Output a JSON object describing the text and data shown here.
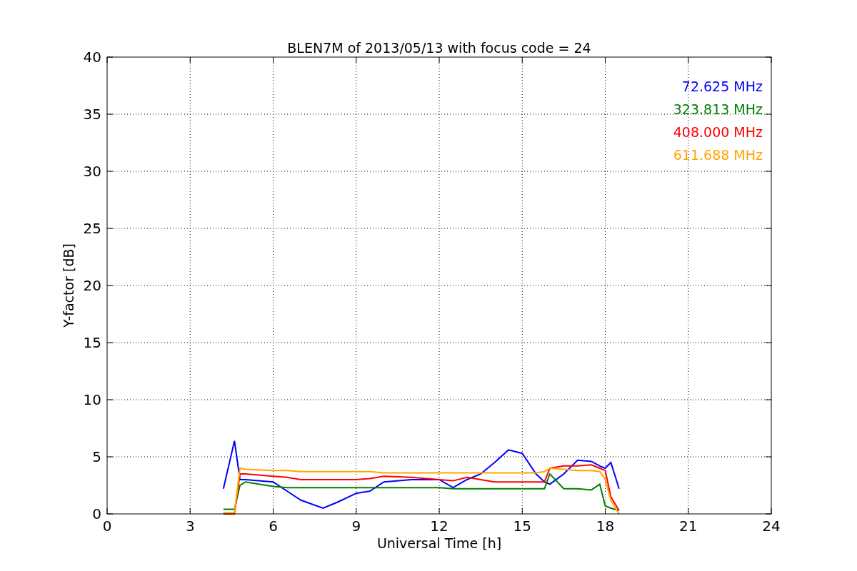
{
  "chart_data": {
    "type": "line",
    "title": "BLEN7M of 2013/05/13 with focus code = 24",
    "xlabel": "Universal Time [h]",
    "ylabel": "Y-factor [dB]",
    "x": [
      4.2,
      4.6,
      4.8,
      5,
      6,
      6.5,
      7,
      7.8,
      8.3,
      9,
      9.5,
      10,
      11,
      12,
      12.5,
      13,
      13.5,
      14,
      14.5,
      15,
      15.5,
      15.8,
      16,
      16.5,
      17,
      17.5,
      17.8,
      18,
      18.2,
      18.5
    ],
    "series": [
      {
        "name": "72.625 MHz",
        "color": "#0000ff",
        "values": [
          2.2,
          6.4,
          3.0,
          3.0,
          2.8,
          2.0,
          1.2,
          0.5,
          1.0,
          1.8,
          2.0,
          2.8,
          3.0,
          3.0,
          2.3,
          3.0,
          3.5,
          4.5,
          5.6,
          5.3,
          3.5,
          2.8,
          2.6,
          3.5,
          4.7,
          4.6,
          4.2,
          4.0,
          4.5,
          2.2
        ]
      },
      {
        "name": "323.813 MHz",
        "color": "#008000",
        "values": [
          0.4,
          0.4,
          2.5,
          2.8,
          2.4,
          2.3,
          2.3,
          2.3,
          2.3,
          2.3,
          2.3,
          2.3,
          2.3,
          2.3,
          2.2,
          2.2,
          2.2,
          2.2,
          2.2,
          2.2,
          2.2,
          2.2,
          3.5,
          2.2,
          2.2,
          2.1,
          2.6,
          0.7,
          0.5,
          0.3
        ]
      },
      {
        "name": "408.000 MHz",
        "color": "#ff0000",
        "values": [
          0,
          0,
          3.5,
          3.5,
          3.3,
          3.2,
          3.0,
          3.0,
          3.0,
          3.0,
          3.1,
          3.3,
          3.2,
          3.0,
          2.9,
          3.2,
          3.0,
          2.8,
          2.8,
          2.8,
          2.8,
          2.8,
          4.0,
          4.2,
          4.2,
          4.3,
          4.0,
          3.8,
          1.5,
          0.3
        ]
      },
      {
        "name": "611.688 MHz",
        "color": "#ffa500",
        "values": [
          0.1,
          0.1,
          4.0,
          3.9,
          3.8,
          3.8,
          3.7,
          3.7,
          3.7,
          3.7,
          3.7,
          3.6,
          3.6,
          3.6,
          3.6,
          3.6,
          3.6,
          3.6,
          3.6,
          3.6,
          3.6,
          3.7,
          4.0,
          3.9,
          3.8,
          3.8,
          3.7,
          3.0,
          1.2,
          0
        ]
      }
    ],
    "xlim": [
      0,
      24
    ],
    "ylim": [
      0,
      40
    ],
    "xticks": [
      0,
      3,
      6,
      9,
      12,
      15,
      18,
      21,
      24
    ],
    "yticks": [
      0,
      5,
      10,
      15,
      20,
      25,
      30,
      35,
      40
    ],
    "grid": true
  }
}
